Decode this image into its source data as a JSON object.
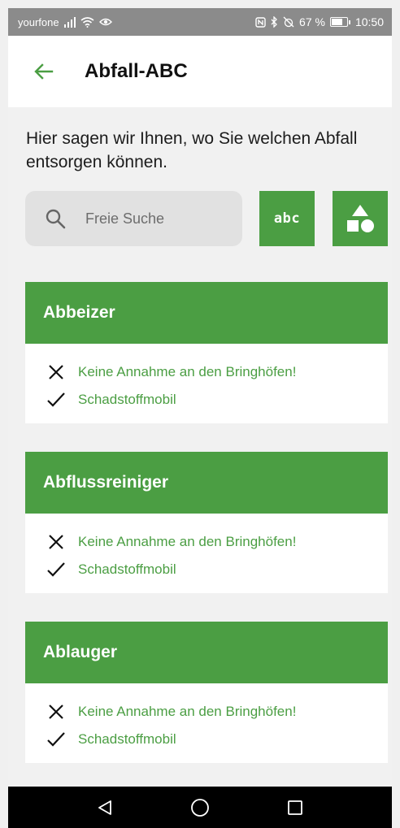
{
  "status_bar": {
    "carrier": "yourfone",
    "battery_text": "67 %",
    "battery_level": 0.67,
    "time": "10:50",
    "icons": [
      "signal-icon",
      "wifi-icon",
      "eye-icon",
      "nfc-icon",
      "bluetooth-icon",
      "alarm-off-icon",
      "battery-icon"
    ]
  },
  "header": {
    "title": "Abfall-ABC",
    "back_icon": "arrow-left-icon"
  },
  "intro_text": "Hier sagen wir Ihnen, wo Sie welchen Abfall entsorgen können.",
  "search": {
    "placeholder": "Freie Suche",
    "value": ""
  },
  "filter_buttons": {
    "abc_label": "abc",
    "shapes_icon": "shapes-icon"
  },
  "items": [
    {
      "title": "Abbeizer",
      "rows": [
        {
          "icon": "cross-icon",
          "text": "Keine Annahme an den Bringhöfen!"
        },
        {
          "icon": "check-icon",
          "text": "Schadstoffmobil"
        }
      ]
    },
    {
      "title": "Abflussreiniger",
      "rows": [
        {
          "icon": "cross-icon",
          "text": "Keine Annahme an den Bringhöfen!"
        },
        {
          "icon": "check-icon",
          "text": "Schadstoffmobil"
        }
      ]
    },
    {
      "title": "Ablauger",
      "rows": [
        {
          "icon": "cross-icon",
          "text": "Keine Annahme an den Bringhöfen!"
        },
        {
          "icon": "check-icon",
          "text": "Schadstoffmobil"
        }
      ]
    }
  ],
  "nav_bar": {
    "icons": [
      "back-triangle-icon",
      "home-circle-icon",
      "recents-square-icon"
    ]
  },
  "colors": {
    "accent": "#4b9e43",
    "status_bar": "#8b8b8b",
    "background": "#f1f1f1"
  }
}
